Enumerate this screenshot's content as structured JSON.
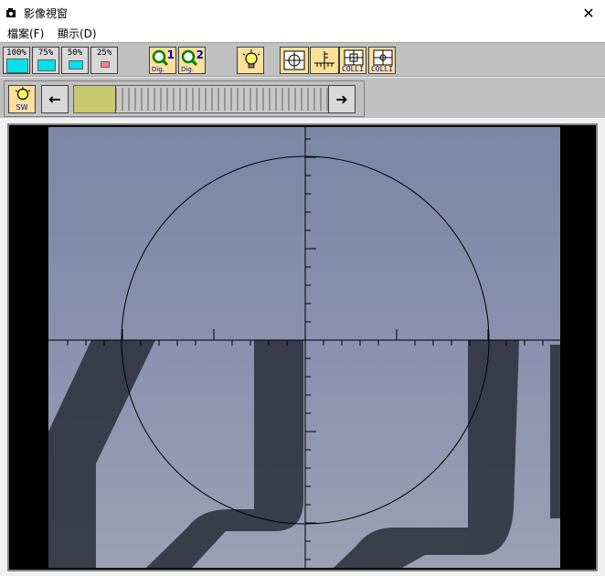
{
  "window": {
    "title": "影像視窗",
    "close_glyph": "✕"
  },
  "menu": [
    {
      "label": "檔案(F)"
    },
    {
      "label": "顯示(D)"
    }
  ],
  "toolbar": {
    "zoom_buttons": [
      {
        "label": "100%"
      },
      {
        "label": "75%"
      },
      {
        "label": "50%"
      },
      {
        "label": "25%"
      }
    ],
    "dig_buttons": [
      {
        "num": "1",
        "label": "Dig."
      },
      {
        "num": "2",
        "label": "Dig."
      }
    ],
    "colli_labels": [
      "COLLI",
      "COLLI"
    ],
    "sw_label": "SW",
    "left_arrow": "←",
    "right_arrow": "➜",
    "slider_fraction": 0.16
  },
  "colors": {
    "accent_yellow": "#fbe09a",
    "cyan": "#00e0e8",
    "image_bg": "#8890a8"
  }
}
